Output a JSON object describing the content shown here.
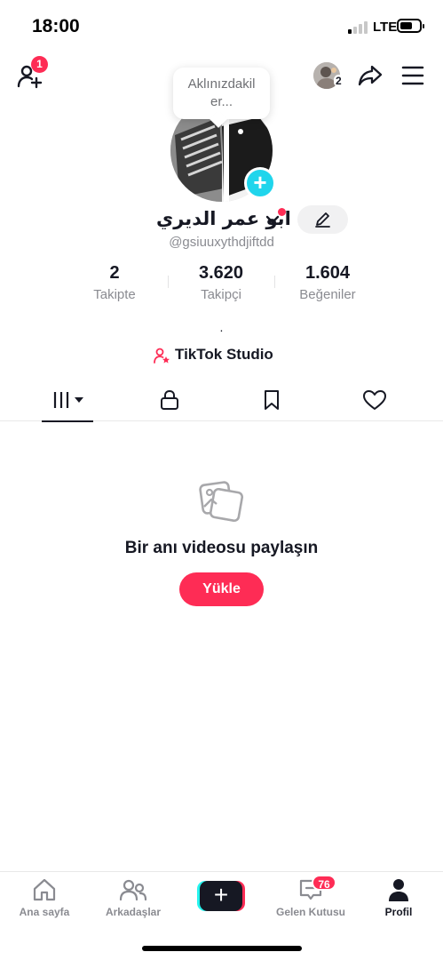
{
  "status_bar": {
    "time": "18:00",
    "network": "LTE"
  },
  "top_bar": {
    "add_friends_badge": "1",
    "story_count": "2"
  },
  "profile": {
    "note_bubble": "Aklınızdakil er...",
    "display_name": "ابو عمر الديري",
    "handle": "@gsiuuxythdjiftdd",
    "bio": "."
  },
  "stats": [
    {
      "value": "2",
      "label": "Takipte"
    },
    {
      "value": "3.620",
      "label": "Takipçi"
    },
    {
      "value": "1.604",
      "label": "Beğeniler"
    }
  ],
  "studio": {
    "label": "TikTok Studio"
  },
  "tabs": [
    {
      "icon": "grid-icon",
      "active": true
    },
    {
      "icon": "lock-icon",
      "active": false
    },
    {
      "icon": "bookmark-icon",
      "active": false
    },
    {
      "icon": "heart-icon",
      "active": false
    }
  ],
  "empty_state": {
    "title": "Bir anı videosu paylaşın",
    "button": "Yükle"
  },
  "bottom_nav": {
    "items": [
      {
        "label": "Ana sayfa",
        "icon": "home-icon",
        "active": false
      },
      {
        "label": "Arkadaşlar",
        "icon": "friends-icon",
        "active": false
      },
      {
        "label": "",
        "icon": "create-icon",
        "active": false
      },
      {
        "label": "Gelen Kutusu",
        "icon": "inbox-icon",
        "active": false
      },
      {
        "label": "Profil",
        "icon": "profile-icon",
        "active": true
      }
    ],
    "inbox_badge": "76"
  },
  "colors": {
    "accent": "#fe2c55",
    "cyan": "#25f4ee",
    "text": "#161823",
    "muted": "#8a8b91"
  }
}
